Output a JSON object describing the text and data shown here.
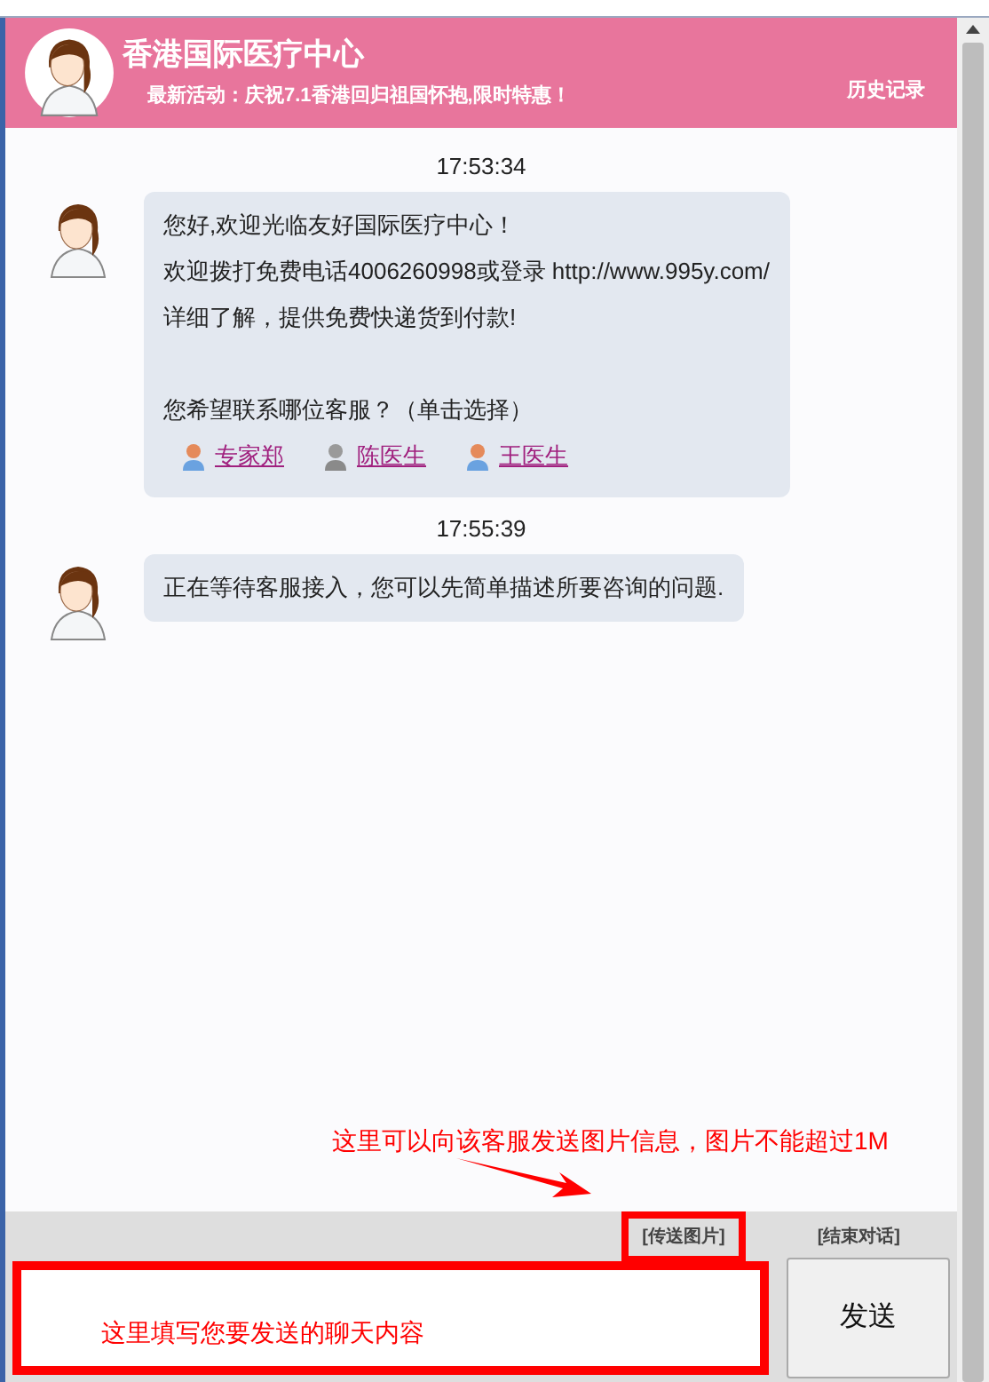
{
  "header": {
    "title": "香港国际医疗中心",
    "promo": "最新活动：庆祝7.1香港回归祖国怀抱,限时特惠！",
    "history_link": "历史记录"
  },
  "messages": [
    {
      "time": "17:53:34",
      "lines": [
        "您好,欢迎光临友好国际医疗中心！",
        "欢迎拨打免费电话4006260998或登录 http://www.995y.com/",
        "详细了解，提供免费快递货到付款!"
      ],
      "question": "您希望联系哪位客服？（单击选择）",
      "agents": [
        {
          "name": "专家郑",
          "online": true
        },
        {
          "name": "陈医生",
          "online": false
        },
        {
          "name": "王医生",
          "online": true
        }
      ]
    },
    {
      "time": "17:55:39",
      "lines": [
        "正在等待客服接入，您可以先简单描述所要咨询的问题."
      ]
    }
  ],
  "toolbar": {
    "send_image": "[传送图片]",
    "end_chat": "[结束对话]"
  },
  "send_button": "发送",
  "annotations": {
    "image_hint": "这里可以向该客服发送图片信息，图片不能超过1M",
    "input_hint": "这里填写您要发送的聊天内容"
  }
}
